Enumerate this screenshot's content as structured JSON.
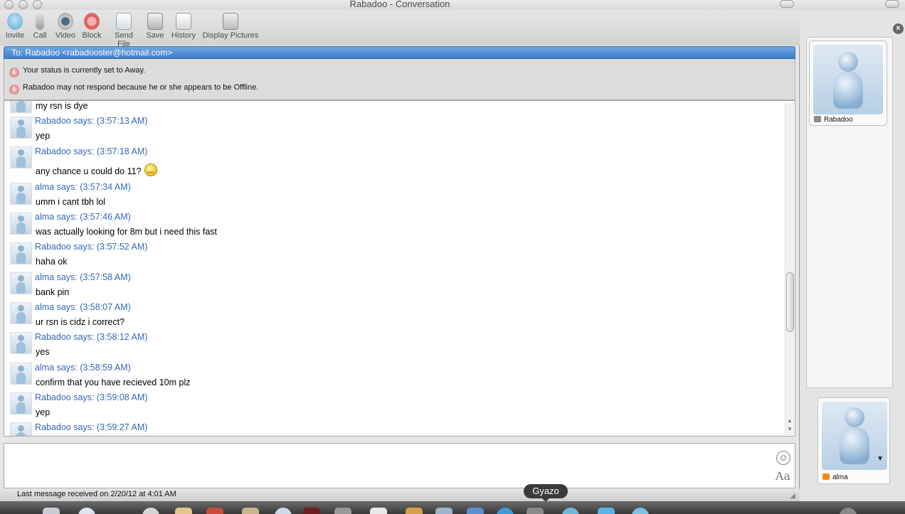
{
  "window": {
    "title": "Rabadoo - Conversation"
  },
  "toolbar": {
    "buttons": [
      {
        "label": "Invite",
        "icon": "invite-icon"
      },
      {
        "label": "Call",
        "icon": "microphone-icon"
      },
      {
        "label": "Video",
        "icon": "webcam-icon"
      },
      {
        "label": "Block",
        "icon": "block-icon"
      },
      {
        "label": "Send File",
        "icon": "send-file-icon"
      },
      {
        "label": "Save",
        "icon": "floppy-disk-icon"
      },
      {
        "label": "History",
        "icon": "history-icon"
      },
      {
        "label": "Display Pictures",
        "icon": "display-pictures-icon"
      }
    ]
  },
  "to_bar": {
    "text": "To: Rabadoo <rabadooster@hotmail.com>"
  },
  "notices": [
    "Your status is currently set to Away.",
    "Rabadoo may not respond because he or she appears to be Offline."
  ],
  "messages": [
    {
      "header": "",
      "text": "my rsn is dye"
    },
    {
      "header": "Rabadoo says: (3:57:13 AM)",
      "text": "yep"
    },
    {
      "header": "Rabadoo says: (3:57:18 AM)",
      "text": "any chance u could do 11?",
      "emoticon": "smiley-icon"
    },
    {
      "header": "alma says: (3:57:34 AM)",
      "text": "umm i cant tbh lol"
    },
    {
      "header": "alma says: (3:57:46 AM)",
      "text": "was actually looking for 8m but i need this fast"
    },
    {
      "header": "Rabadoo says: (3:57:52 AM)",
      "text": "haha ok"
    },
    {
      "header": "alma says: (3:57:58 AM)",
      "text": "bank pin"
    },
    {
      "header": "alma says: (3:58:07 AM)",
      "text": "ur rsn is cidz i correct?"
    },
    {
      "header": "Rabadoo says: (3:58:12 AM)",
      "text": "yes"
    },
    {
      "header": "alma says: (3:58:59 AM)",
      "text": "confirm that you have recieved 10m plz"
    },
    {
      "header": "Rabadoo says: (3:59:08 AM)",
      "text": "yep"
    },
    {
      "header": "Rabadoo says: (3:59:27 AM)",
      "text": ""
    }
  ],
  "input": {
    "value": "",
    "emoticon_button": "☺",
    "font_button": "Aa"
  },
  "status_bar": {
    "text": "Last message received on 2/20/12 at 4:01 AM"
  },
  "drawer": {
    "contact": {
      "name": "Rabadoo",
      "status_color": "#8a8a8a"
    },
    "self": {
      "name": "alma",
      "status_color": "#f08a1c"
    }
  },
  "tooltip": {
    "text": "Gyazo"
  },
  "colors": {
    "accent": "#3f7dc8",
    "sender_text": "#3466b8"
  }
}
